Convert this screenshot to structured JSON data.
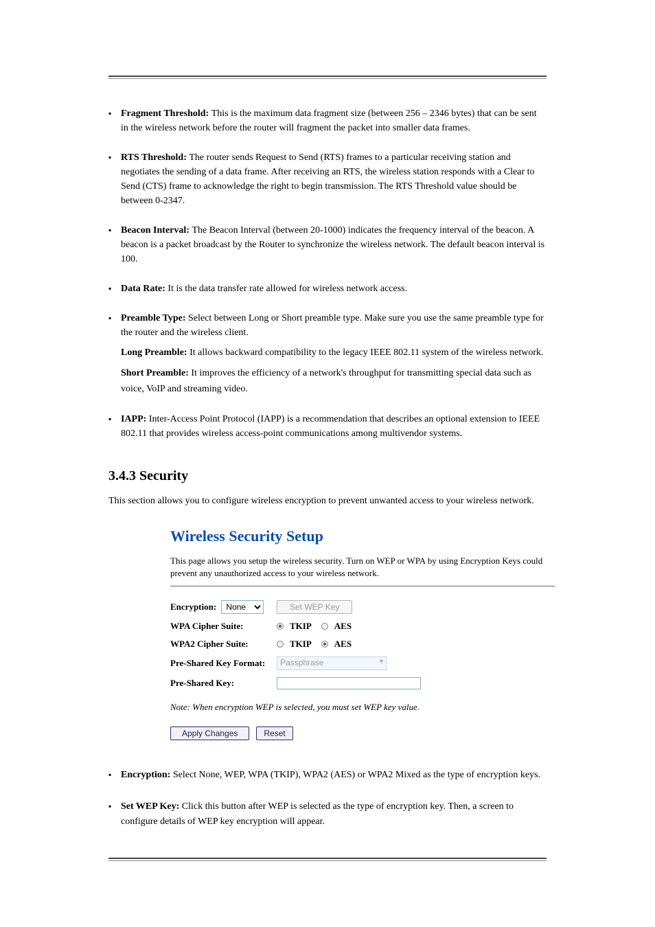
{
  "bullets_a": [
    {
      "term": "Fragment Threshold: ",
      "text": "This is the maximum data fragment size (between 256 – 2346 bytes) that can be sent in the wireless network before the router will fragment the packet into smaller data frames."
    },
    {
      "term": "RTS Threshold: ",
      "text": "The router sends Request to Send (RTS) frames to a particular receiving station and negotiates the sending of a data frame. After receiving an RTS, the wireless station responds with a Clear to Send (CTS) frame to acknowledge the right to begin transmission. The RTS Threshold value should be between 0-2347."
    },
    {
      "term": "Beacon Interval: ",
      "text": "The Beacon Interval (between 20-1000) indicates the frequency interval of the beacon. A beacon is a packet broadcast by the Router to synchronize the wireless network. The default beacon interval is 100."
    },
    {
      "term": "Data Rate: ",
      "text": "It is the data transfer rate allowed for wireless network access."
    },
    {
      "term": "Preamble Type: ",
      "text": "Select between Long or Short preamble type. Make sure you use the same preamble type for the router and the wireless client. "
    }
  ],
  "preamble": {
    "long_label": "Long Preamble: ",
    "long_text": "It allows backward compatibility to the legacy IEEE 802.11 system of the wireless network.",
    "short_label": "Short Preamble: ",
    "short_text": "It improves the efficiency of a network's throughput for transmitting special data such as voice, VoIP and streaming video."
  },
  "iapp": {
    "term": "IAPP: ",
    "text": "Inter-Access Point Protocol (IAPP) is a recommendation that describes an optional extension to IEEE 802.11 that provides wireless access-point communications among multivendor systems."
  },
  "section": {
    "head": "3.4.3 Security",
    "desc": "This section allows you to configure wireless encryption to prevent unwanted access to your wireless network."
  },
  "shot": {
    "title": "Wireless Security Setup",
    "intro": "This page allows you setup the wireless security. Turn on WEP or WPA by using Encryption Keys could prevent any unauthorized access to your wireless network.",
    "encryption_label": "Encryption:",
    "encryption_value": "None",
    "wep_button": "Set WEP Key",
    "wpa_label": "WPA Cipher Suite:",
    "wpa_tkip": "TKIP",
    "wpa_aes": "AES",
    "wpa2_label": "WPA2 Cipher Suite:",
    "wpa2_tkip": "TKIP",
    "wpa2_aes": "AES",
    "pskf_label": "Pre-Shared Key Format:",
    "pskf_value": "Passphrase",
    "psk_label": "Pre-Shared Key:",
    "note": "Note: When encryption WEP is selected, you must set WEP key value.",
    "apply": "Apply Changes",
    "reset": "Reset"
  },
  "bullets_b": [
    {
      "term": "Encryption: ",
      "text": "Select None, WEP, WPA (TKIP), WPA2 (AES) or WPA2 Mixed as the type of encryption keys."
    },
    {
      "term": "Set WEP Key: ",
      "text": "Click this button after WEP is selected as the type of encryption key. Then, a screen to configure details of WEP key encryption will appear."
    }
  ]
}
